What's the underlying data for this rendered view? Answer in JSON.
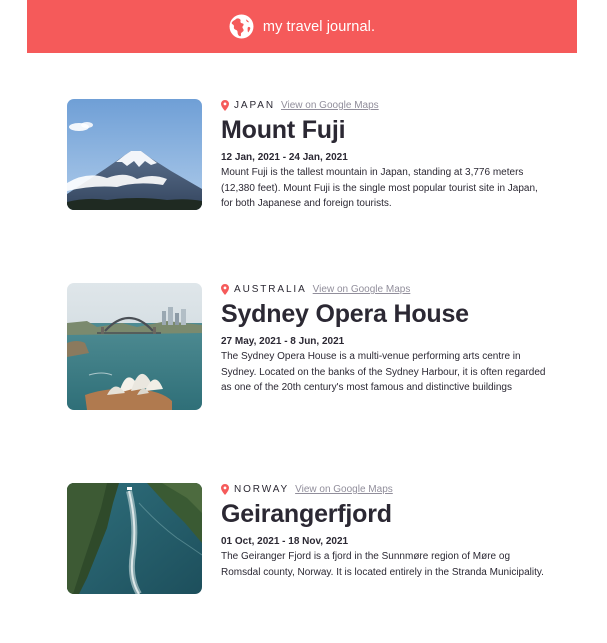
{
  "header": {
    "title": "my travel journal.",
    "icon": "globe-icon",
    "background_color": "#f55a5a"
  },
  "entries": [
    {
      "country": "JAPAN",
      "maps_link_label": "View on Google Maps",
      "title": "Mount Fuji",
      "dates": "12 Jan, 2021 - 24 Jan, 2021",
      "description": "Mount Fuji is the tallest mountain in Japan, standing at 3,776 meters (12,380 feet). Mount Fuji is the single most popular tourist site in Japan, for both Japanese and foreign tourists."
    },
    {
      "country": "AUSTRALIA",
      "maps_link_label": "View on Google Maps",
      "title": "Sydney Opera House",
      "dates": "27 May, 2021 - 8 Jun, 2021",
      "description": "The Sydney Opera House is a multi-venue performing arts centre in Sydney. Located on the banks of the Sydney Harbour, it is often regarded as one of the 20th century's most famous and distinctive buildings"
    },
    {
      "country": "NORWAY",
      "maps_link_label": "View on Google Maps",
      "title": "Geirangerfjord",
      "dates": "01 Oct, 2021 - 18 Nov, 2021",
      "description": "The Geiranger Fjord is a fjord in the Sunnmøre region of Møre og Romsdal county, Norway. It is located entirely in the Stranda Municipality."
    }
  ],
  "colors": {
    "accent": "#f55a5a",
    "text": "#2b2833",
    "link": "#918e9b"
  }
}
